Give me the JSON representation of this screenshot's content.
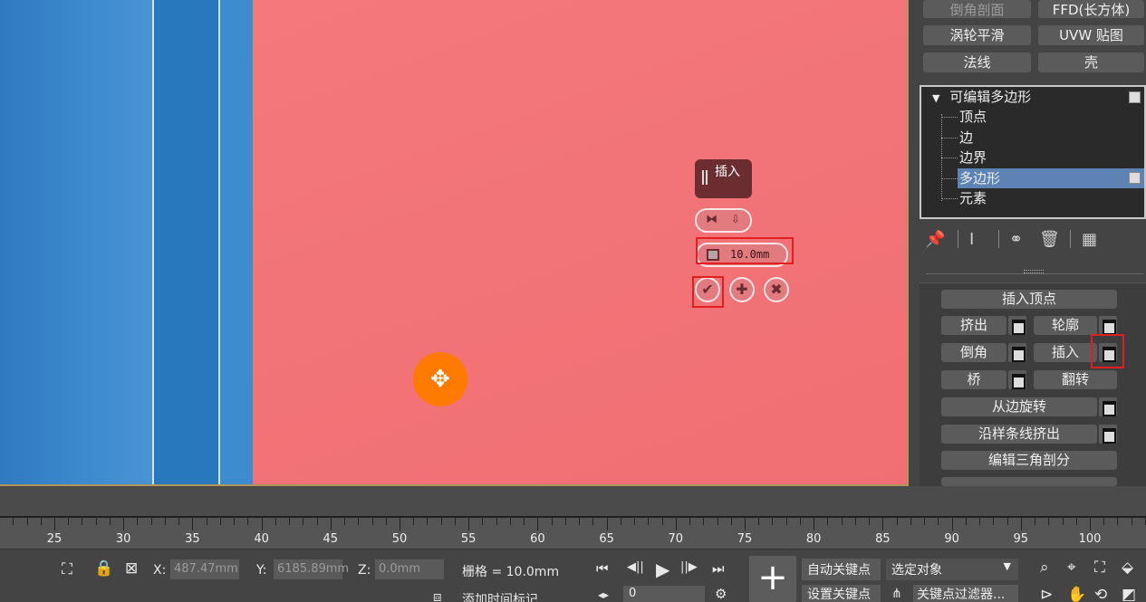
{
  "modifier_buttons": [
    {
      "label": "倒角剖面",
      "dim": true
    },
    {
      "label": "FFD(长方体)",
      "dim": false
    },
    {
      "label": "涡轮平滑",
      "dim": false
    },
    {
      "label": "UVW 贴图",
      "dim": false
    },
    {
      "label": "法线",
      "dim": false
    },
    {
      "label": "壳",
      "dim": false
    }
  ],
  "modifier_stack": {
    "root": "可编辑多边形",
    "items": [
      "顶点",
      "边",
      "边界",
      "多边形",
      "元素"
    ],
    "selected": "多边形"
  },
  "caddy": {
    "title": "插入",
    "amount": "10.0mm",
    "ok_glyph": "✔",
    "apply_glyph": "✚",
    "cancel_glyph": "✖"
  },
  "edit_polygons": {
    "insert_vertex": "插入顶点",
    "extrude": "挤出",
    "outline": "轮廓",
    "bevel": "倒角",
    "inset": "插入",
    "bridge": "桥",
    "flip": "翻转",
    "hinge_from_edge": "从边旋转",
    "extrude_along_spline": "沿样条线挤出",
    "edit_triangulation": "编辑三角剖分"
  },
  "timeline": {
    "ticks": [
      "25",
      "30",
      "35",
      "40",
      "45",
      "50",
      "55",
      "60",
      "65",
      "70",
      "75",
      "80",
      "85",
      "90",
      "95",
      "100"
    ]
  },
  "status": {
    "x_label": "X:",
    "x_value": "487.47mm",
    "y_label": "Y:",
    "y_value": "6185.89mm",
    "z_label": "Z:",
    "z_value": "0.0mm",
    "grid": "栅格 = 10.0mm",
    "add_time_tag": "添加时间标记",
    "auto_key": "自动关键点",
    "set_key": "设置关键点",
    "selected_dropdown": "选定对象",
    "key_filters": "关键点过滤器...",
    "frame": "0"
  },
  "icons": {
    "play": "▶",
    "go_start": "⏮",
    "prev_frame": "◀||",
    "next_frame": "||▶",
    "go_end": "⏭"
  }
}
